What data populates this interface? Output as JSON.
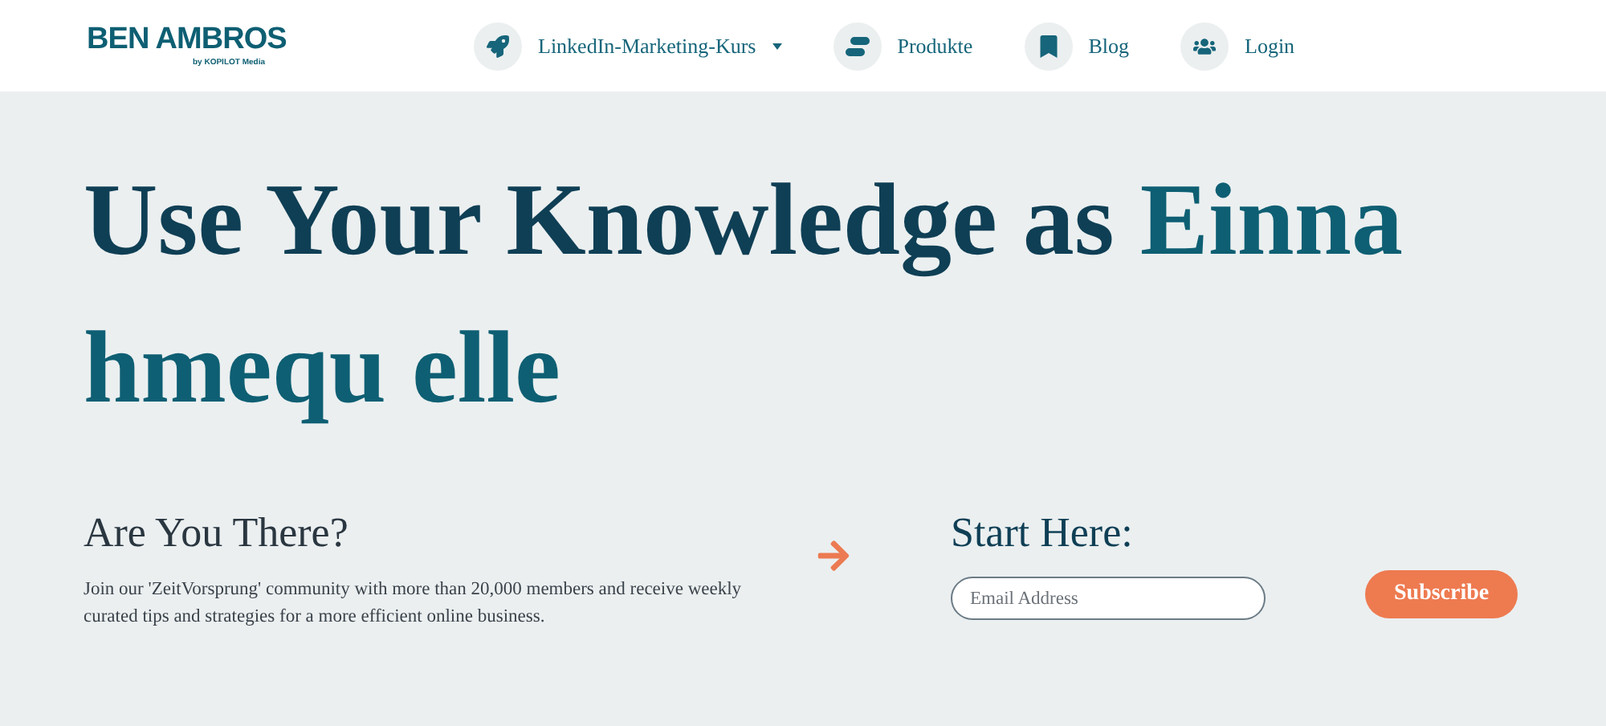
{
  "logo": {
    "name": "BEN AMBROS",
    "tagline": "by KOPILOT Media"
  },
  "nav": [
    {
      "kind": "dropdown",
      "label": "LinkedIn-Marketing-Kurs"
    },
    {
      "kind": "link",
      "label": "Produkte"
    },
    {
      "kind": "link",
      "label": "Blog"
    },
    {
      "kind": "link",
      "label": "Login"
    }
  ],
  "hero": {
    "heading_lead": "Use Your Knowledge as",
    "heading_accent_lines": [
      "Einna",
      "hmequ elle"
    ]
  },
  "newsletter": {
    "title": "Are You There?",
    "text": "Join our 'ZeitVorsprung' community with more than 20,000 members and receive weekly curated tips and strategies for a more efficient online business.",
    "form_title": "Start Here:",
    "email": {
      "placeholder": "Email Address"
    },
    "button": "Subscribe"
  }
}
